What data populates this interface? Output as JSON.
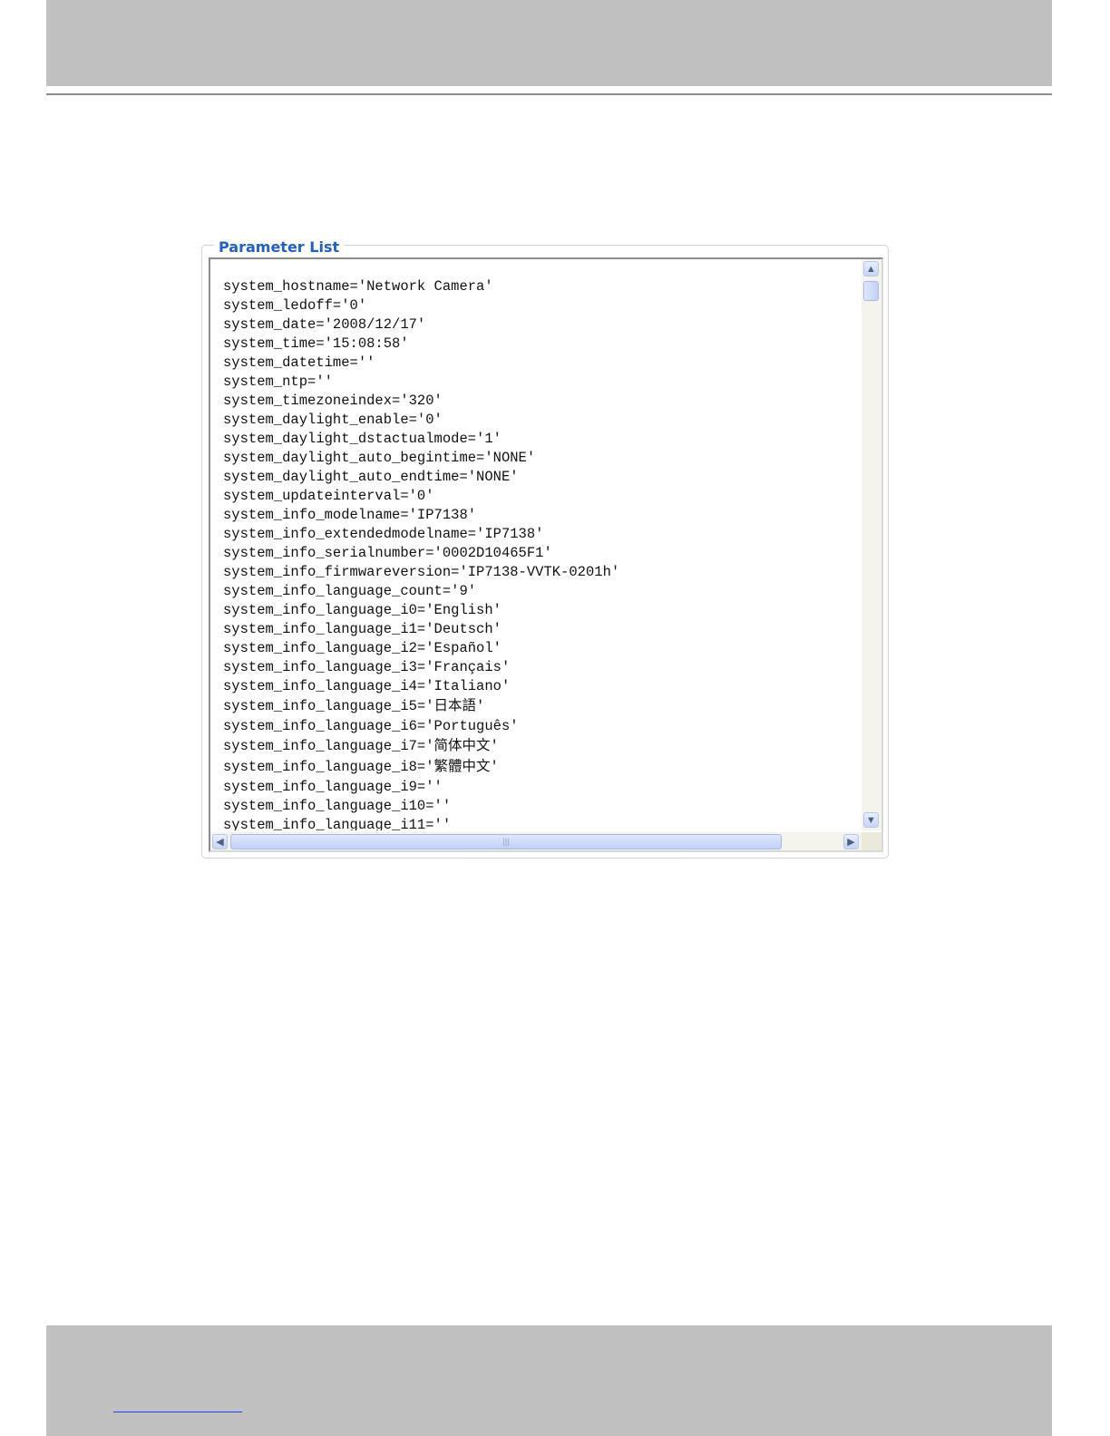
{
  "panel": {
    "legend": "Parameter List",
    "lines": [
      "system_hostname='Network Camera'",
      "system_ledoff='0'",
      "system_date='2008/12/17'",
      "system_time='15:08:58'",
      "system_datetime=''",
      "system_ntp=''",
      "system_timezoneindex='320'",
      "system_daylight_enable='0'",
      "system_daylight_dstactualmode='1'",
      "system_daylight_auto_begintime='NONE'",
      "system_daylight_auto_endtime='NONE'",
      "system_updateinterval='0'",
      "system_info_modelname='IP7138'",
      "system_info_extendedmodelname='IP7138'",
      "system_info_serialnumber='0002D10465F1'",
      "system_info_firmwareversion='IP7138-VVTK-0201h'",
      "system_info_language_count='9'",
      "system_info_language_i0='English'",
      "system_info_language_i1='Deutsch'",
      "system_info_language_i2='Español'",
      "system_info_language_i3='Français'",
      "system_info_language_i4='Italiano'",
      "system_info_language_i5='日本語'",
      "system_info_language_i6='Português'",
      "system_info_language_i7='简体中文'",
      "system_info_language_i8='繁體中文'",
      "system_info_language_i9=''",
      "system_info_language_i10=''",
      "system_info_language_i11=''"
    ]
  },
  "icons": {
    "scroll_up": "chevron-up-icon",
    "scroll_down": "chevron-down-icon",
    "scroll_left": "chevron-left-icon",
    "scroll_right": "chevron-right-icon"
  }
}
